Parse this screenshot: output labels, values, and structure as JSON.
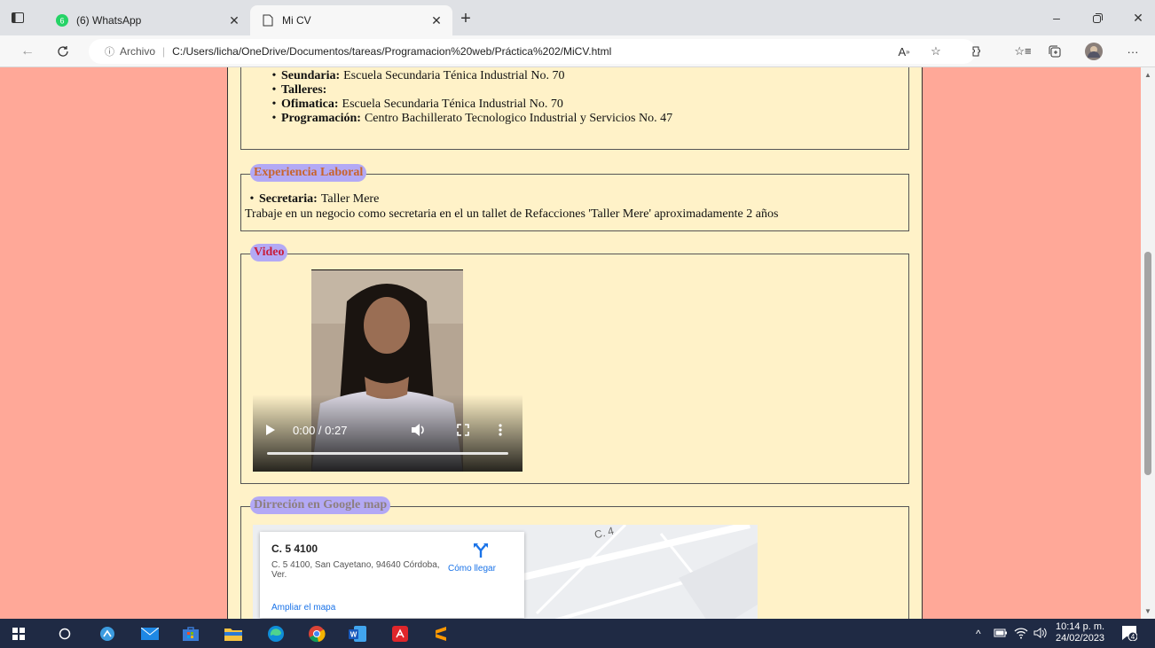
{
  "browser": {
    "tabs": [
      {
        "title": "(6) WhatsApp",
        "badge": "6"
      },
      {
        "title": "Mi CV"
      }
    ],
    "address": {
      "info_label": "Archivo",
      "url": "C:/Users/licha/OneDrive/Documentos/tareas/Programacion%20web/Práctica%202/MiCV.html"
    }
  },
  "education": {
    "items": [
      {
        "label": "Seundaria:",
        "value": "Escuela Secundaria Ténica Industrial No. 70"
      },
      {
        "label": "Talleres:",
        "value": ""
      },
      {
        "label": "Ofimatica:",
        "value": "Escuela Secundaria Ténica Industrial No. 70"
      },
      {
        "label": "Programación:",
        "value": "Centro Bachillerato Tecnologico Industrial y Servicios No. 47"
      }
    ]
  },
  "work": {
    "legend": "Experiencia Laboral",
    "item_label": "Secretaria:",
    "item_value": "Taller Mere",
    "description": "Trabaje en un negocio como secretaria en el un tallet de Refacciones 'Taller Mere' aproximadamente 2 años"
  },
  "video": {
    "legend": "Video",
    "time": "0:00 / 0:27",
    "progress": 0
  },
  "map": {
    "legend": "Dirreción en Google map",
    "place": "C. 5 4100",
    "address": "C. 5 4100, San Cayetano, 94640 Córdoba, Ver.",
    "directions_label": "Cómo llegar",
    "enlarge_label": "Ampliar el mapa",
    "road_label": "C. 4"
  },
  "taskbar": {
    "time": "10:14 p. m.",
    "date": "24/02/2023",
    "notifications": "4"
  },
  "colors": {
    "page_bg": "#ffa898",
    "content_bg": "#fff2c8",
    "legend_bg": "#b3a9f5"
  }
}
